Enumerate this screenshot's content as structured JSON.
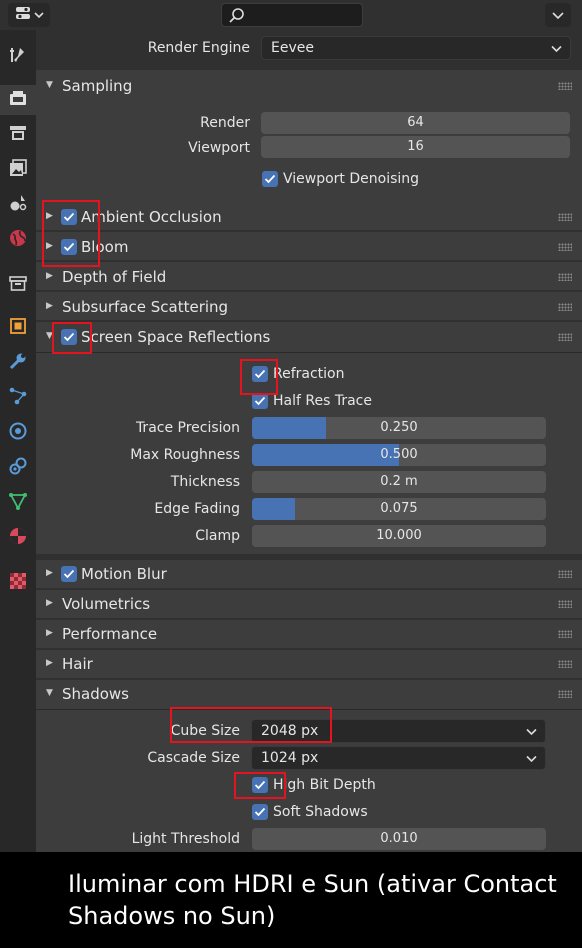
{
  "colors": {
    "accent": "#4772b3",
    "highlight_box": "#e3141f",
    "panel_bg": "#3d3d3d",
    "window_bg": "#303030"
  },
  "header": {
    "editor_icon": "properties-editor-icon",
    "search_icon": "search-icon",
    "options_icon": "chevron-down-icon"
  },
  "sidebar": {
    "tabs": [
      {
        "icon": "tool-icon"
      },
      {
        "icon": "render-icon",
        "active": true
      },
      {
        "icon": "output-icon"
      },
      {
        "icon": "view-layer-icon"
      },
      {
        "icon": "scene-icon"
      },
      {
        "icon": "world-icon"
      },
      {
        "icon": "collection-icon"
      },
      {
        "icon": "object-icon"
      },
      {
        "icon": "modifier-icon"
      },
      {
        "icon": "particles-icon"
      },
      {
        "icon": "physics-icon"
      },
      {
        "icon": "constraints-icon"
      },
      {
        "icon": "data-icon"
      },
      {
        "icon": "material-icon"
      },
      {
        "icon": "texture-icon"
      }
    ]
  },
  "render_engine": {
    "label": "Render Engine",
    "value": "Eevee"
  },
  "sampling": {
    "title": "Sampling",
    "render_label": "Render",
    "render_value": "64",
    "viewport_label": "Viewport",
    "viewport_value": "16",
    "denoise_label": "Viewport Denoising"
  },
  "panels": {
    "ambient_occlusion": "Ambient Occlusion",
    "bloom": "Bloom",
    "depth_of_field": "Depth of Field",
    "subsurface": "Subsurface Scattering",
    "ssr": "Screen Space Reflections",
    "motion_blur": "Motion Blur",
    "volumetrics": "Volumetrics",
    "performance": "Performance",
    "hair": "Hair",
    "shadows": "Shadows"
  },
  "ssr": {
    "refraction_label": "Refraction",
    "half_res_label": "Half Res Trace",
    "fields": [
      {
        "label": "Trace Precision",
        "value": "0.250",
        "fill": 0.25
      },
      {
        "label": "Max Roughness",
        "value": "0.500",
        "fill": 0.5
      },
      {
        "label": "Thickness",
        "value": "0.2 m",
        "fill": 0
      },
      {
        "label": "Edge Fading",
        "value": "0.075",
        "fill": 0.145
      },
      {
        "label": "Clamp",
        "value": "10.000",
        "fill": 0
      }
    ]
  },
  "shadows": {
    "cube_size_label": "Cube Size",
    "cube_size_value": "2048 px",
    "cascade_size_label": "Cascade Size",
    "cascade_size_value": "1024 px",
    "high_bit_label": "High Bit Depth",
    "soft_shadows_label": "Soft Shadows",
    "light_threshold_label": "Light Threshold",
    "light_threshold_value": "0.010"
  },
  "caption": "Iluminar com HDRI e Sun (ativar Contact Shadows no Sun)"
}
